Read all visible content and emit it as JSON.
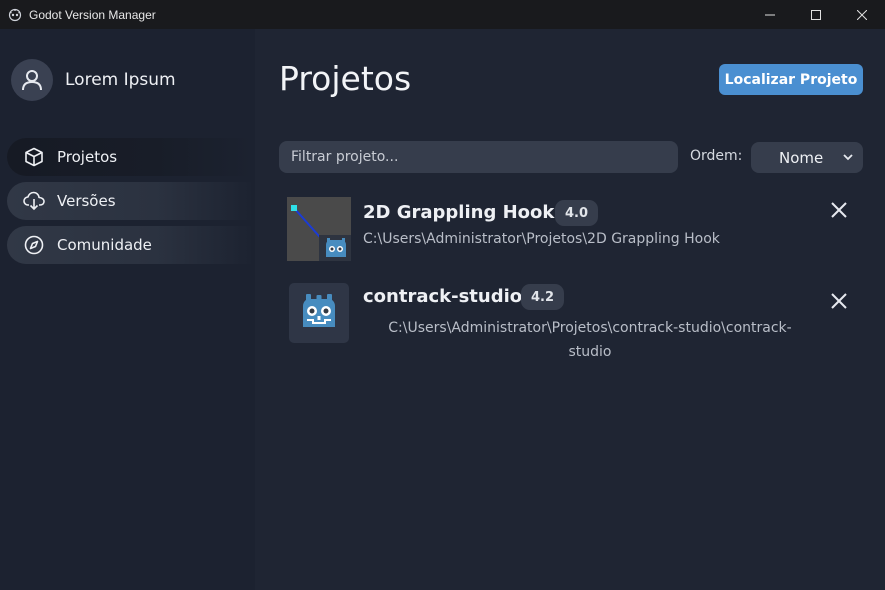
{
  "window": {
    "title": "Godot Version Manager"
  },
  "sidebar": {
    "user_name": "Lorem Ipsum",
    "items": [
      {
        "label": "Projetos",
        "icon": "cube-icon",
        "active": true
      },
      {
        "label": "Versões",
        "icon": "cloud-download-icon",
        "active": false
      },
      {
        "label": "Comunidade",
        "icon": "compass-icon",
        "active": false
      }
    ]
  },
  "main": {
    "title": "Projetos",
    "locate_button": "Localizar Projeto",
    "filter_placeholder": "Filtrar projeto...",
    "order_label": "Ordem:",
    "order_value": "Nome",
    "projects": [
      {
        "name": "2D Grappling Hook",
        "version": "4.0",
        "path": "C:\\Users\\Administrator\\Projetos\\2D Grappling Hook"
      },
      {
        "name": "contrack-studio",
        "version": "4.2",
        "path": "C:\\Users\\Administrator\\Projetos\\contrack-studio\\contrack-studio"
      }
    ]
  },
  "colors": {
    "accent": "#4a8fd1",
    "background": "#1f2533",
    "sidebar": "#1c2230",
    "input": "#363d4c",
    "godot_blue": "#478cbf"
  }
}
